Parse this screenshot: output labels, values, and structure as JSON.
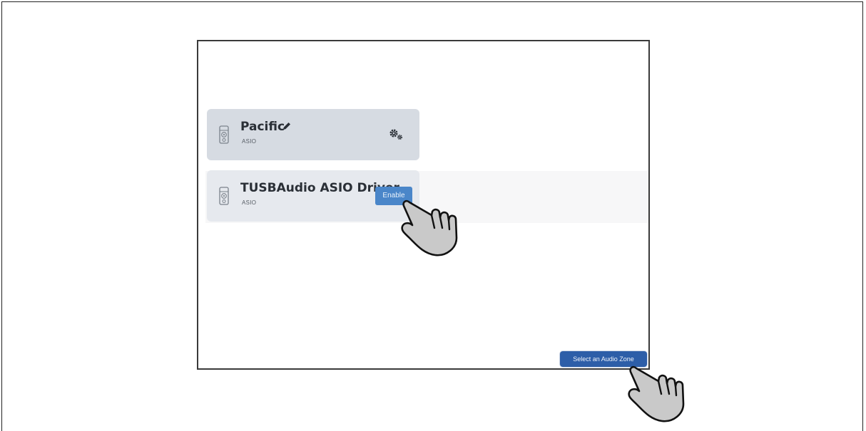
{
  "zones": [
    {
      "name": "Pacific",
      "type": "ASIO",
      "icon": "speaker-icon",
      "action_icon": "gear-icon",
      "edit_icon": "pencil-icon"
    },
    {
      "name": "TUSBAudio ASIO Driver",
      "type": "ASIO",
      "icon": "speaker-icon",
      "action_label": "Enable"
    }
  ],
  "footer": {
    "select_zone_label": "Select an Audio Zone"
  },
  "colors": {
    "accent": "#4a86c9",
    "primary_button": "#2d5ea8",
    "card_selected": "#d6dbe2",
    "card": "#e6e9ee"
  }
}
